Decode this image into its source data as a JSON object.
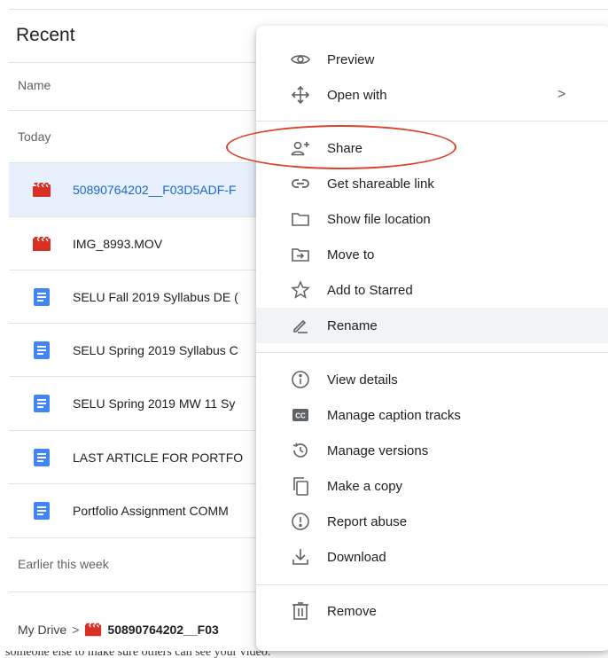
{
  "page": {
    "title": "Recent",
    "column_header": "Name"
  },
  "sections": {
    "today": "Today",
    "earlier": "Earlier this week"
  },
  "files": [
    {
      "name": "50890764202__F03D5ADF-F",
      "icon": "video-file-icon",
      "selected": true
    },
    {
      "name": "IMG_8993.MOV",
      "icon": "video-file-icon",
      "selected": false
    },
    {
      "name": "SELU Fall 2019 Syllabus DE (",
      "icon": "google-doc-icon",
      "selected": false
    },
    {
      "name": "SELU Spring 2019 Syllabus C",
      "icon": "google-doc-icon",
      "selected": false
    },
    {
      "name": "SELU Spring 2019 MW 11 Sy",
      "icon": "google-doc-icon",
      "selected": false
    },
    {
      "name": "LAST ARTICLE FOR PORTFO",
      "icon": "google-doc-icon",
      "selected": false
    },
    {
      "name": "Portfolio Assignment COMM",
      "icon": "google-doc-icon",
      "selected": false
    }
  ],
  "breadcrumb": {
    "root": "My Drive",
    "separator": ">",
    "file": "50890764202__F03"
  },
  "bottom_text": "someone else to make sure others can see your video.",
  "menu": {
    "items": [
      {
        "label": "Preview",
        "icon": "eye-icon"
      },
      {
        "label": "Open with",
        "icon": "move-arrows-icon",
        "chevron": ">"
      },
      {
        "label": "Share",
        "icon": "add-person-icon"
      },
      {
        "label": "Get shareable link",
        "icon": "link-icon"
      },
      {
        "label": "Show file location",
        "icon": "folder-icon"
      },
      {
        "label": "Move to",
        "icon": "move-to-folder-icon"
      },
      {
        "label": "Add to Starred",
        "icon": "star-icon"
      },
      {
        "label": "Rename",
        "icon": "pencil-icon"
      },
      {
        "label": "View details",
        "icon": "info-icon"
      },
      {
        "label": "Manage caption tracks",
        "icon": "captions-icon"
      },
      {
        "label": "Manage versions",
        "icon": "history-icon"
      },
      {
        "label": "Make a copy",
        "icon": "copy-icon"
      },
      {
        "label": "Report abuse",
        "icon": "report-icon"
      },
      {
        "label": "Download",
        "icon": "download-icon"
      },
      {
        "label": "Remove",
        "icon": "trash-icon"
      }
    ]
  },
  "colors": {
    "accent": "#1967d2",
    "selected_row": "#e8f0fe",
    "highlight": "#d9442b",
    "video_icon": "#d93025",
    "doc_icon": "#4285f4"
  }
}
